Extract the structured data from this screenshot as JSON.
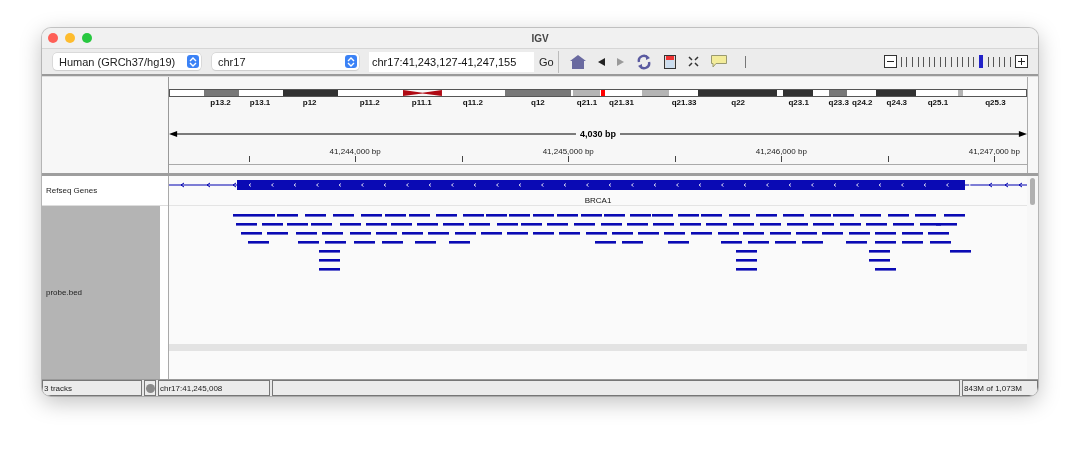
{
  "window": {
    "title": "IGV"
  },
  "toolbar": {
    "genome": {
      "value": "Human (GRCh37/hg19)"
    },
    "chromosome": {
      "value": "chr17"
    },
    "locus": {
      "value": "chr17:41,243,127-41,247,155"
    },
    "go": "Go",
    "tools": [
      {
        "kind": "home",
        "disabled": false
      },
      {
        "kind": "back",
        "disabled": false
      },
      {
        "kind": "forward",
        "disabled": true
      },
      {
        "kind": "refresh",
        "disabled": false
      },
      {
        "kind": "region",
        "disabled": false
      },
      {
        "kind": "fit",
        "disabled": false
      },
      {
        "kind": "popup",
        "disabled": false
      }
    ],
    "zoom": {
      "level": 0.737
    }
  },
  "ideogram": {
    "bands": [
      {
        "kind": "band",
        "color": "#ffffff"
      },
      {
        "label": "p13.2",
        "kind": "band",
        "color": "#787878"
      },
      {
        "label": "p13.1",
        "kind": "band",
        "color": "#ffffff"
      },
      {
        "label": "p12",
        "kind": "band",
        "color": "#323232"
      },
      {
        "label": "p11.2",
        "kind": "band",
        "color": "#ffffff"
      },
      {
        "label": "p11.1",
        "kind": "centromere",
        "color": "#b00a14"
      },
      {
        "label": "q11.2",
        "kind": "band",
        "color": "#ffffff"
      },
      {
        "label": "q12",
        "kind": "band",
        "color": "#787878"
      },
      {
        "kind": "band",
        "color": "#ffffff"
      },
      {
        "label": "q21.1",
        "kind": "band",
        "color": "#b4b4b4"
      },
      {
        "label": "q21.31",
        "kind": "band",
        "color": "#ffffff"
      },
      {
        "kind": "band",
        "color": "#b4b4b4"
      },
      {
        "label": "q21.33",
        "kind": "band",
        "color": "#ffffff"
      },
      {
        "label": "q22",
        "kind": "band",
        "color": "#323232"
      },
      {
        "kind": "band",
        "color": "#ffffff"
      },
      {
        "label": "q23.1",
        "kind": "band",
        "color": "#323232"
      },
      {
        "kind": "band",
        "color": "#ffffff"
      },
      {
        "label": "q23.3",
        "kind": "band",
        "color": "#787878"
      },
      {
        "label": "q24.2",
        "kind": "band",
        "color": "#ffffff"
      },
      {
        "label": "q24.3",
        "kind": "band",
        "color": "#323232"
      },
      {
        "label": "q25.1",
        "kind": "band",
        "color": "#ffffff"
      },
      {
        "kind": "band",
        "color": "#b4b4b4"
      },
      {
        "label": "q25.3",
        "kind": "band",
        "color": "#ffffff"
      }
    ]
  },
  "ruler": {
    "span": "4,030 bp",
    "ticks": [
      "41,244,000 bp",
      "41,245,000 bp",
      "41,246,000 bp",
      "41,247,000 bp"
    ]
  },
  "tracks": [
    {
      "name": "Refseq Genes",
      "kind": "gene",
      "features": [
        {
          "label": "BRCA1",
          "reverse": true
        }
      ]
    },
    {
      "name": "probe.bed",
      "kind": "bed"
    }
  ],
  "status_bar": {
    "tracks": "3 tracks",
    "position": "chr17:41,245,008",
    "memory": "843M of 1,073M"
  }
}
